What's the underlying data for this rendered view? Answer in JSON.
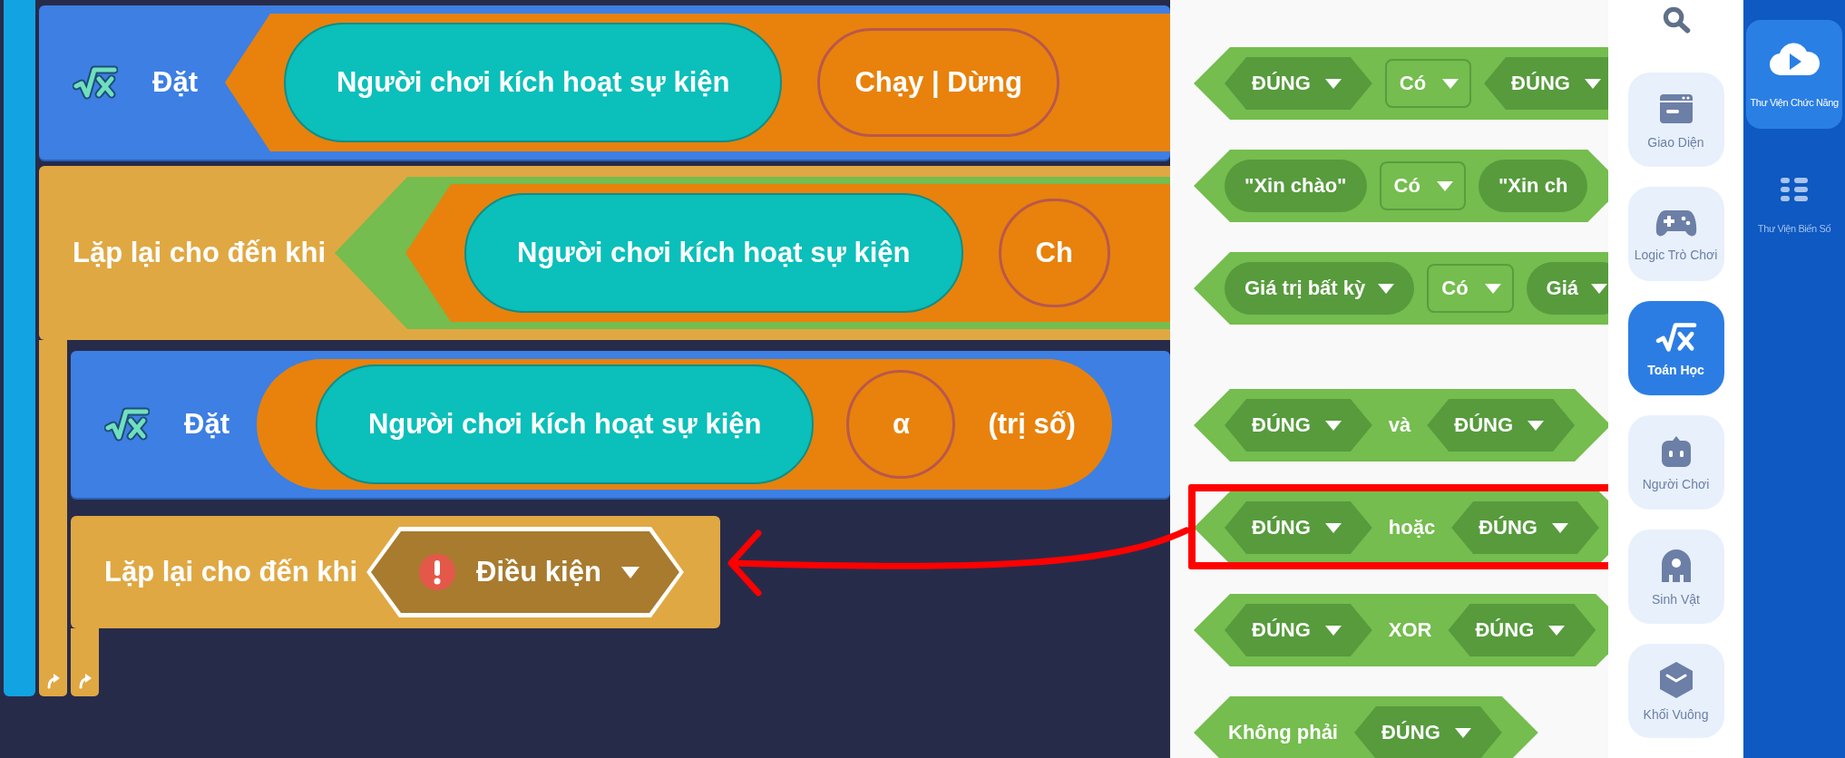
{
  "workspace": {
    "blocks": [
      {
        "kind": "set",
        "label": "Đặt",
        "inputs": [
          {
            "kind": "wedge",
            "inputs": [
              {
                "kind": "pill",
                "text": "Người chơi kích hoạt sự kiện"
              },
              {
                "kind": "round",
                "text": "Chạy | Dừng"
              }
            ]
          }
        ]
      },
      {
        "kind": "repeat",
        "label": "Lặp lại cho đến khi",
        "inputs": [
          {
            "kind": "hex",
            "inputs": [
              {
                "kind": "wedge",
                "inputs": [
                  {
                    "kind": "pill",
                    "text": "Người chơi kích hoạt sự kiện"
                  },
                  {
                    "kind": "round",
                    "text": "Ch"
                  }
                ]
              }
            ]
          }
        ],
        "children": [
          {
            "kind": "set",
            "label": "Đặt",
            "inputs": [
              {
                "kind": "capsule",
                "inputs": [
                  {
                    "kind": "pill",
                    "text": "Người chơi kích hoạt sự kiện"
                  },
                  {
                    "kind": "round",
                    "text": "α"
                  },
                  {
                    "kind": "text",
                    "text": "(trị số)"
                  }
                ]
              }
            ]
          },
          {
            "kind": "repeat",
            "label": "Lặp lại cho đến khi",
            "inputs": [
              {
                "kind": "slot",
                "text": "Điều kiện",
                "warning": true
              }
            ]
          }
        ]
      }
    ]
  },
  "palette": {
    "groups": [
      {
        "blocks": [
          {
            "highlighted": false,
            "parts": [
              {
                "kind": "bool",
                "text": "ĐÚNG"
              },
              {
                "kind": "select",
                "text": "Có"
              },
              {
                "kind": "bool",
                "text": "ĐÚNG"
              }
            ]
          },
          {
            "highlighted": false,
            "parts": [
              {
                "kind": "string",
                "text": "\"Xin chào\""
              },
              {
                "kind": "select",
                "text": "Có"
              },
              {
                "kind": "string",
                "text": "\"Xin ch"
              }
            ]
          },
          {
            "highlighted": false,
            "parts": [
              {
                "kind": "any",
                "text": "Giá trị bất kỳ"
              },
              {
                "kind": "select",
                "text": "Có"
              },
              {
                "kind": "any",
                "text": "Giá"
              }
            ]
          }
        ]
      },
      {
        "blocks": [
          {
            "highlighted": false,
            "parts": [
              {
                "kind": "bool",
                "text": "ĐÚNG"
              },
              {
                "kind": "text",
                "text": "và"
              },
              {
                "kind": "bool",
                "text": "ĐÚNG"
              }
            ]
          },
          {
            "highlighted": true,
            "parts": [
              {
                "kind": "bool",
                "text": "ĐÚNG"
              },
              {
                "kind": "text",
                "text": "hoặc"
              },
              {
                "kind": "bool",
                "text": "ĐÚNG"
              }
            ]
          },
          {
            "highlighted": false,
            "parts": [
              {
                "kind": "bool",
                "text": "ĐÚNG"
              },
              {
                "kind": "text",
                "text": "XOR"
              },
              {
                "kind": "bool",
                "text": "ĐÚNG"
              }
            ]
          },
          {
            "highlighted": false,
            "parts": [
              {
                "kind": "text",
                "text": "Không phải"
              },
              {
                "kind": "bool",
                "text": "ĐÚNG"
              }
            ]
          }
        ]
      }
    ]
  },
  "categories": [
    {
      "label": "Giao Diện",
      "selected": false
    },
    {
      "label": "Logic Trò Chơi",
      "selected": false
    },
    {
      "label": "Toán Học",
      "selected": true
    },
    {
      "label": "Người Chơi",
      "selected": false
    },
    {
      "label": "Sinh Vật",
      "selected": false
    },
    {
      "label": "Khối Vuông",
      "selected": false
    }
  ],
  "libraries": [
    {
      "label": "Thư Viện Chức Năng",
      "selected": true
    },
    {
      "label": "Thư Viện Biến Số",
      "selected": false
    }
  ]
}
